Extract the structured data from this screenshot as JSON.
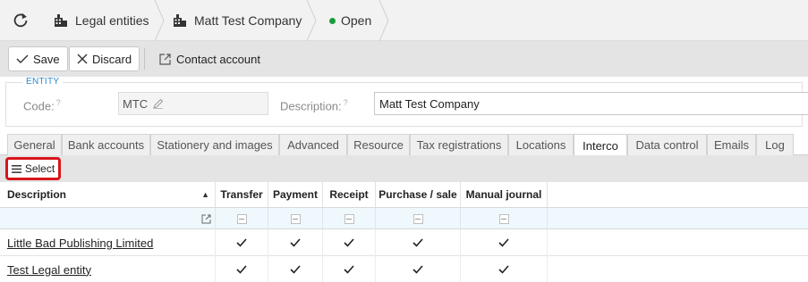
{
  "breadcrumb": {
    "items": [
      "Legal entities",
      "Matt Test Company"
    ],
    "status": "Open",
    "status_color": "#1a9c3c"
  },
  "toolbar": {
    "save_label": "Save",
    "discard_label": "Discard",
    "contact_label": "Contact account"
  },
  "entity": {
    "legend": "ENTITY",
    "code_label": "Code:",
    "code_value": "MTC",
    "description_label": "Description:",
    "description_value": "Matt Test Company"
  },
  "tabs": [
    {
      "label": "General",
      "active": false
    },
    {
      "label": "Bank accounts",
      "active": false
    },
    {
      "label": "Stationery and images",
      "active": false
    },
    {
      "label": "Advanced",
      "active": false
    },
    {
      "label": "Resource",
      "active": false
    },
    {
      "label": "Tax registrations",
      "active": false
    },
    {
      "label": "Locations",
      "active": false
    },
    {
      "label": "Interco",
      "active": true
    },
    {
      "label": "Data control",
      "active": false
    },
    {
      "label": "Emails",
      "active": false
    },
    {
      "label": "Log",
      "active": false
    }
  ],
  "select_label": "Select",
  "select_highlight_color": "#d8151b",
  "grid": {
    "columns": [
      "Description",
      "Transfer",
      "Payment",
      "Receipt",
      "Purchase / sale",
      "Manual journal"
    ],
    "sort_indicator": "▲",
    "rows": [
      {
        "description": "Little Bad Publishing Limited",
        "transfer": true,
        "payment": true,
        "receipt": true,
        "purchase_sale": true,
        "manual_journal": true
      },
      {
        "description": "Test Legal entity",
        "transfer": true,
        "payment": true,
        "receipt": true,
        "purchase_sale": true,
        "manual_journal": true
      }
    ]
  }
}
